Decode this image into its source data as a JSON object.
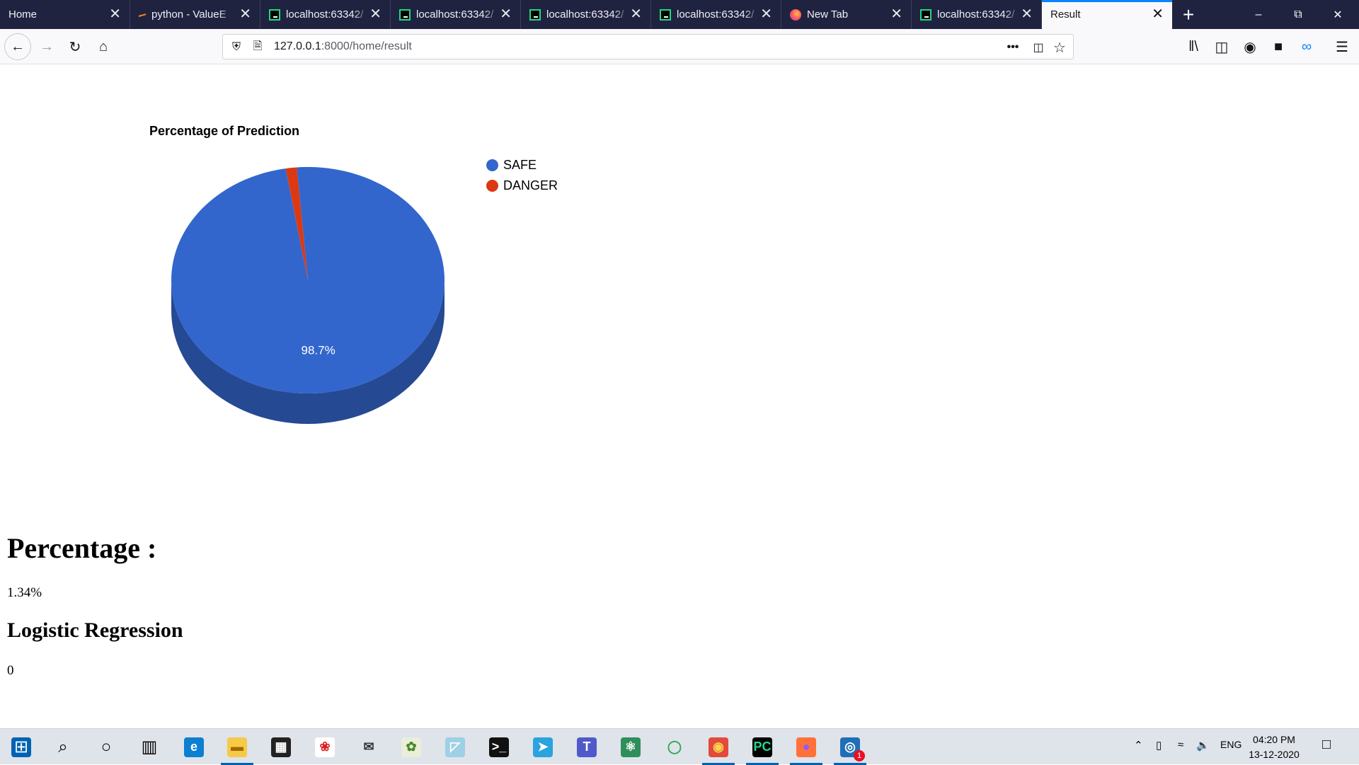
{
  "browser": {
    "tabs": [
      {
        "title": "Home",
        "icon": "blank",
        "active": false
      },
      {
        "title": "python - ValueE",
        "icon": "stackoverflow-icon",
        "active": false
      },
      {
        "title": "localhost:63342/",
        "icon": "pycharm-icon",
        "active": false
      },
      {
        "title": "localhost:63342/",
        "icon": "pycharm-icon",
        "active": false
      },
      {
        "title": "localhost:63342/",
        "icon": "pycharm-icon",
        "active": false
      },
      {
        "title": "localhost:63342/",
        "icon": "pycharm-icon",
        "active": false
      },
      {
        "title": "New Tab",
        "icon": "firefox-icon",
        "active": false
      },
      {
        "title": "localhost:63342/",
        "icon": "pycharm-icon",
        "active": false
      },
      {
        "title": "Result",
        "icon": "blank",
        "active": true
      }
    ],
    "url_host": "127.0.0.1",
    "url_rest": ":8000/home/result",
    "accent": "#0a84ff",
    "tabstrip_bg": "#202340"
  },
  "page": {
    "heading_percentage": "Percentage :",
    "percentage_value": "1.34%",
    "heading_model": "Logistic Regression",
    "model_value": "0"
  },
  "chart_data": {
    "type": "pie",
    "title": "Percentage of Prediction",
    "is_3d": true,
    "legend_position": "right",
    "slices": [
      {
        "label": "SAFE",
        "value": 98.7,
        "color": "#3366cc",
        "data_label": "98.7%"
      },
      {
        "label": "DANGER",
        "value": 1.3,
        "color": "#dc3912",
        "data_label": ""
      }
    ]
  },
  "taskbar": {
    "apps": [
      "start-icon",
      "search-icon",
      "cortana-icon",
      "task-view-icon",
      "edge-icon",
      "file-explorer-icon",
      "store-icon",
      "gift-app-icon",
      "mail-icon",
      "photos-app-icon",
      "notes-app-icon",
      "terminal-icon",
      "telegram-icon",
      "teams-icon",
      "atom-icon",
      "ring-app-icon",
      "chrome-icon",
      "pycharm-icon",
      "firefox-icon",
      "whatsapp-icon"
    ],
    "badge": "1",
    "language": "ENG",
    "time": "04:20 PM",
    "date": "13-12-2020"
  }
}
